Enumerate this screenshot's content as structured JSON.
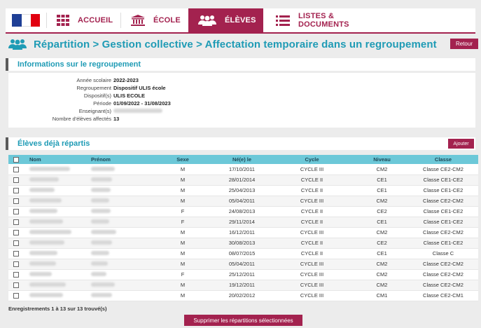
{
  "nav": {
    "items": [
      {
        "label": "ACCUEIL",
        "icon": "grid-icon"
      },
      {
        "label": "ÉCOLE",
        "icon": "school-building-icon"
      },
      {
        "label": "ÉLÈVES",
        "icon": "students-group-icon",
        "active": true
      },
      {
        "label": "LISTES & DOCUMENTS",
        "icon": "list-icon"
      }
    ]
  },
  "page": {
    "title": "Répartition > Gestion collective > Affectation temporaire dans un regroupement",
    "retour_label": "Retour"
  },
  "info": {
    "heading": "Informations sur le regroupement",
    "rows": [
      {
        "label": "Année scolaire",
        "value": "2022-2023"
      },
      {
        "label": "Regroupement",
        "value": "Dispositif ULIS école"
      },
      {
        "label": "Dispositif(s)",
        "value": "ULIS ECOLE"
      },
      {
        "label": "Période",
        "value": "01/09/2022 - 31/08/2023"
      },
      {
        "label": "Enseignant(s)",
        "value": ""
      },
      {
        "label": "Nombre d'élèves affectés",
        "value": "13"
      }
    ]
  },
  "eleves": {
    "heading": "Élèves déjà répartis",
    "ajouter_label": "Ajouter",
    "columns": [
      "Nom",
      "Prénom",
      "Sexe",
      "Né(e) le",
      "Cycle",
      "Niveau",
      "Classe"
    ],
    "rows": [
      {
        "sexe": "M",
        "ne": "17/10/2011",
        "cycle": "CYCLE III",
        "niveau": "CM2",
        "classe": "Classe CE2-CM2"
      },
      {
        "sexe": "M",
        "ne": "28/01/2014",
        "cycle": "CYCLE II",
        "niveau": "CE1",
        "classe": "Classe CE1-CE2"
      },
      {
        "sexe": "M",
        "ne": "25/04/2013",
        "cycle": "CYCLE II",
        "niveau": "CE1",
        "classe": "Classe CE1-CE2"
      },
      {
        "sexe": "M",
        "ne": "05/04/2011",
        "cycle": "CYCLE III",
        "niveau": "CM2",
        "classe": "Classe CE2-CM2"
      },
      {
        "sexe": "F",
        "ne": "24/08/2013",
        "cycle": "CYCLE II",
        "niveau": "CE2",
        "classe": "Classe CE1-CE2"
      },
      {
        "sexe": "F",
        "ne": "29/11/2014",
        "cycle": "CYCLE II",
        "niveau": "CE1",
        "classe": "Classe CE1-CE2"
      },
      {
        "sexe": "M",
        "ne": "16/12/2011",
        "cycle": "CYCLE III",
        "niveau": "CM2",
        "classe": "Classe CE2-CM2"
      },
      {
        "sexe": "M",
        "ne": "30/08/2013",
        "cycle": "CYCLE II",
        "niveau": "CE2",
        "classe": "Classe CE1-CE2"
      },
      {
        "sexe": "M",
        "ne": "08/07/2015",
        "cycle": "CYCLE II",
        "niveau": "CE1",
        "classe": "Classe C"
      },
      {
        "sexe": "M",
        "ne": "05/04/2011",
        "cycle": "CYCLE III",
        "niveau": "CM2",
        "classe": "Classe CE2-CM2"
      },
      {
        "sexe": "F",
        "ne": "25/12/2011",
        "cycle": "CYCLE III",
        "niveau": "CM2",
        "classe": "Classe CE2-CM2"
      },
      {
        "sexe": "M",
        "ne": "19/12/2011",
        "cycle": "CYCLE III",
        "niveau": "CM2",
        "classe": "Classe CE2-CM2"
      },
      {
        "sexe": "M",
        "ne": "20/02/2012",
        "cycle": "CYCLE III",
        "niveau": "CM1",
        "classe": "Classe CE2-CM1"
      }
    ],
    "records_text": "Enregistrements 1 à 13 sur 13 trouvé(s)",
    "supprimer_label": "Supprimer les répartitions sélectionnées"
  },
  "colors": {
    "accent": "#a3224f",
    "title": "#1f9bb5",
    "table_header": "#6cc8d8"
  }
}
